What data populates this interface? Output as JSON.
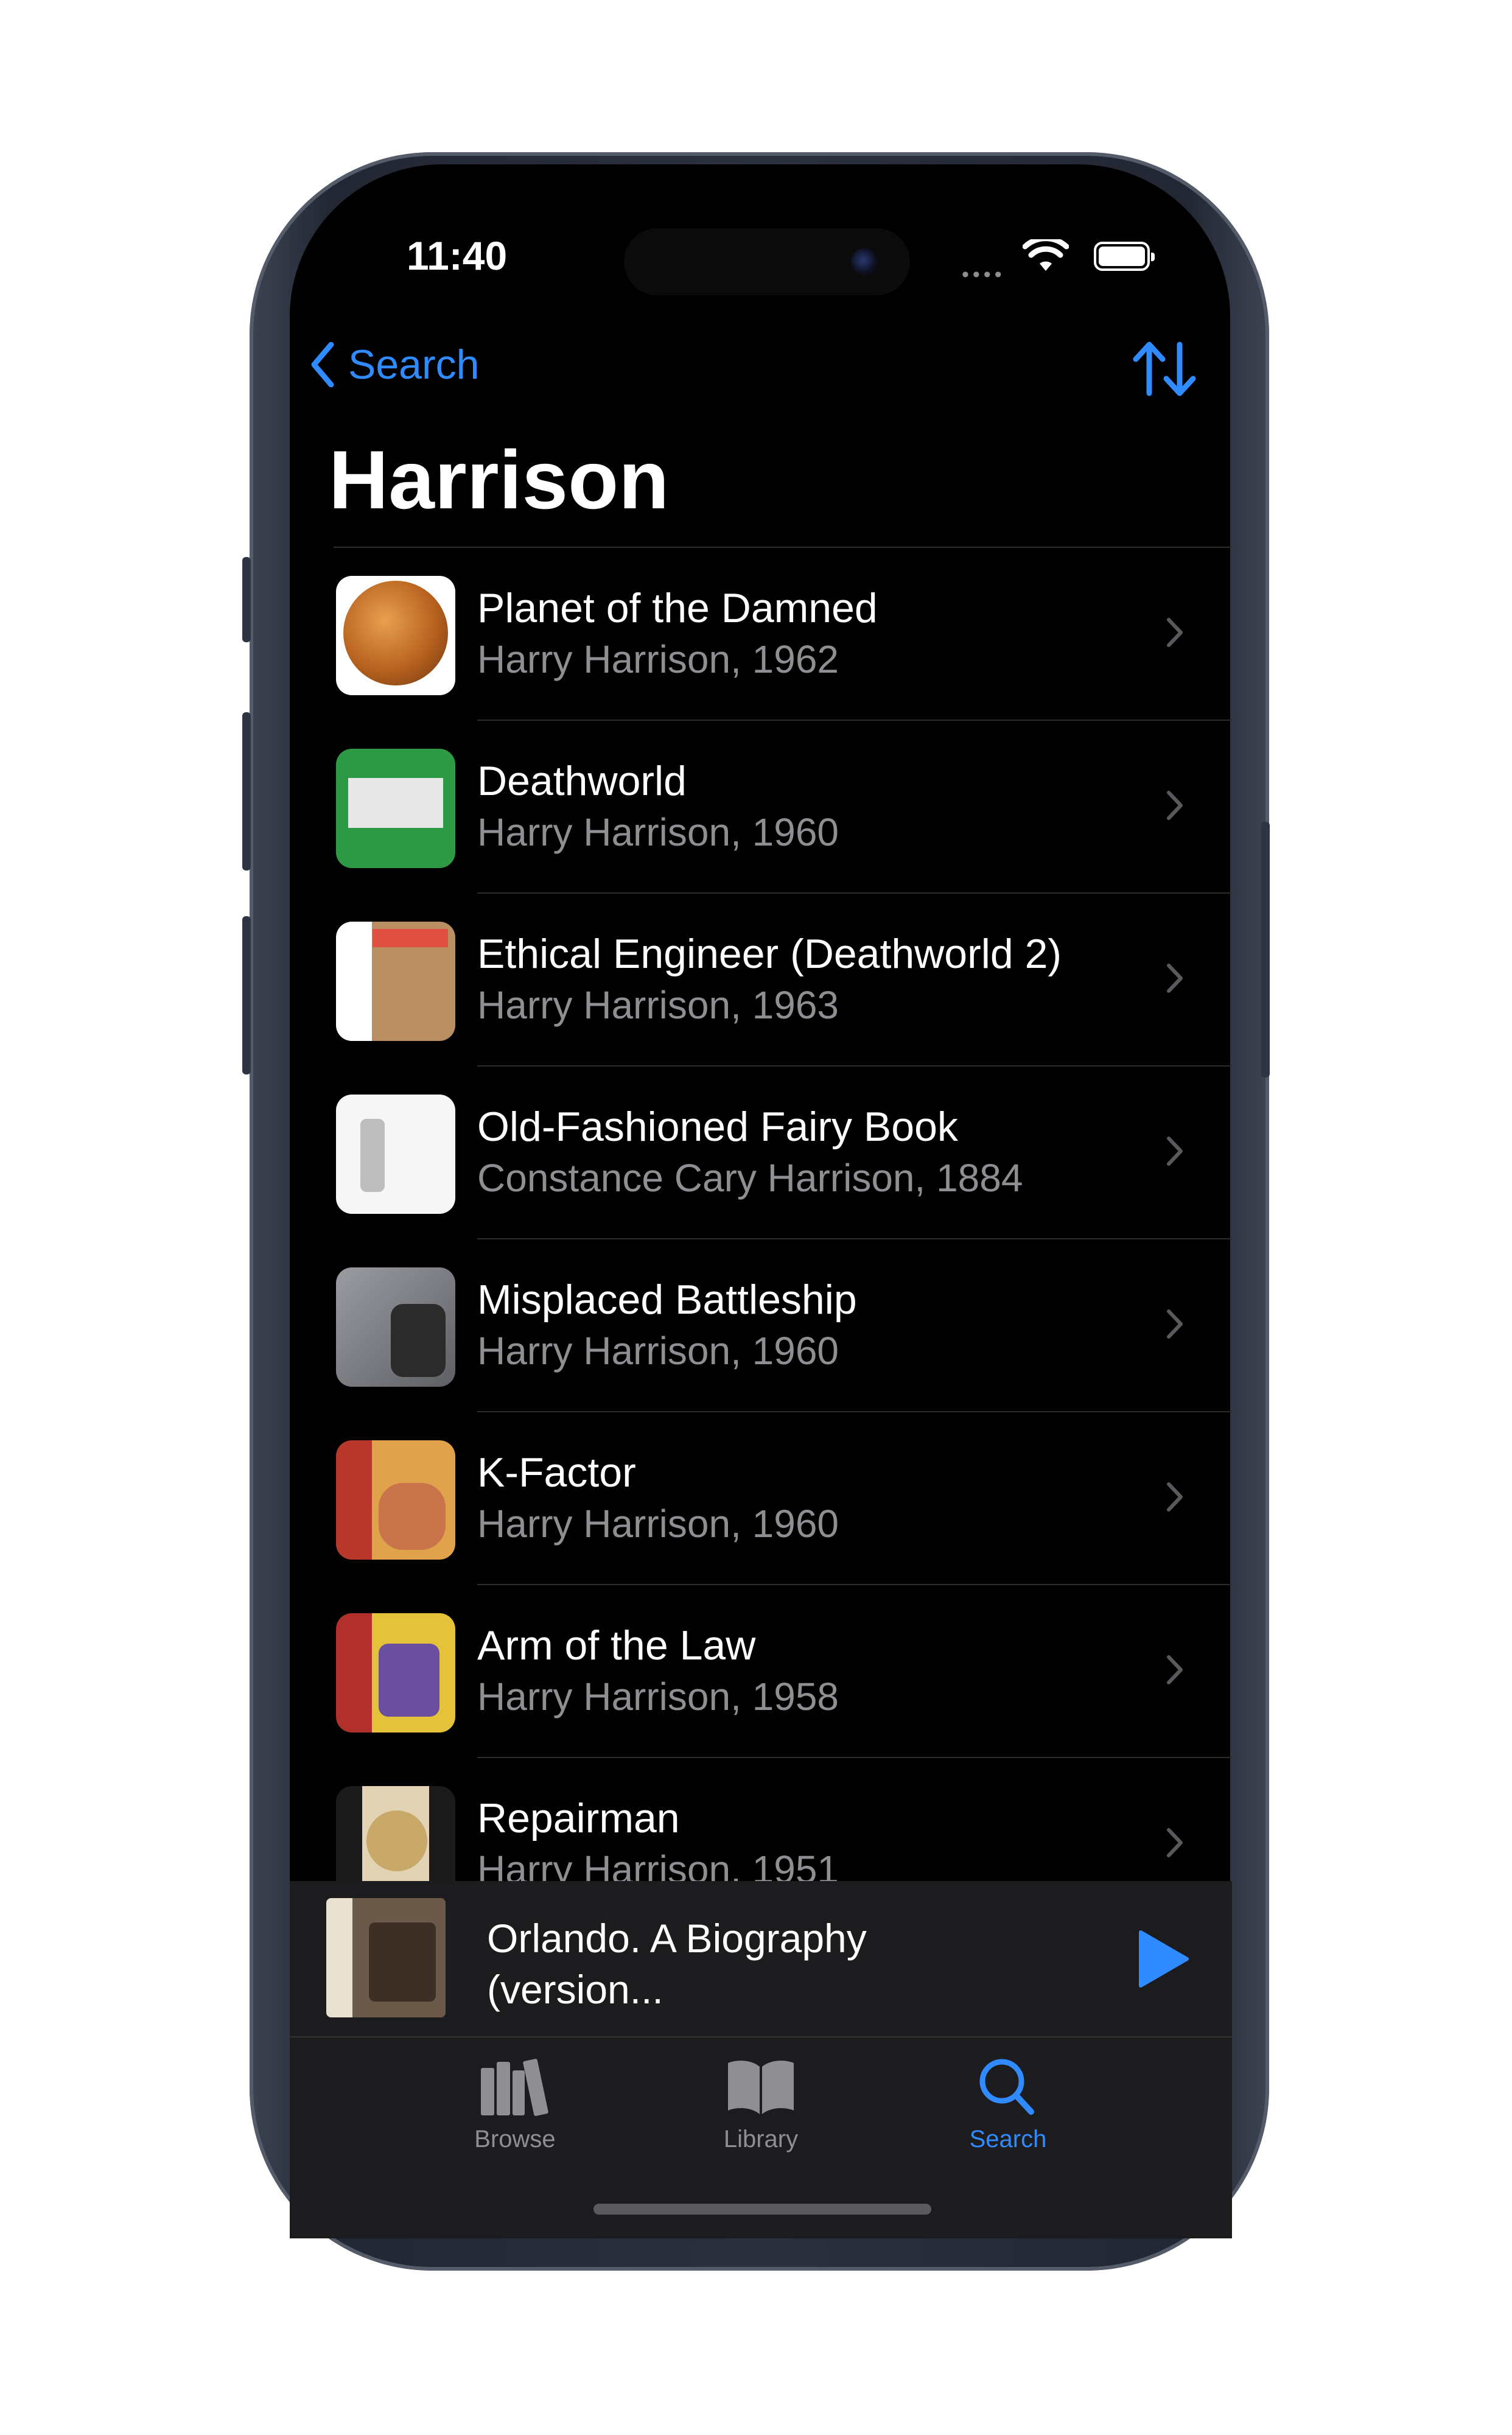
{
  "status": {
    "time": "11:40"
  },
  "nav": {
    "back_label": "Search",
    "title": "Harrison"
  },
  "books": [
    {
      "title": "Planet of the Damned",
      "subtitle": "Harry Harrison, 1962",
      "cover_color": "#c97a2e"
    },
    {
      "title": "Deathworld",
      "subtitle": "Harry Harrison, 1960",
      "cover_color": "#2e9a45"
    },
    {
      "title": "Ethical Engineer (Deathworld 2)",
      "subtitle": "Harry Harrison, 1963",
      "cover_color": "#c8b89a"
    },
    {
      "title": "Old-Fashioned Fairy Book",
      "subtitle": "Constance Cary Harrison, 1884",
      "cover_color": "#f4f4f4"
    },
    {
      "title": "Misplaced Battleship",
      "subtitle": "Harry Harrison, 1960",
      "cover_color": "#8a8d93"
    },
    {
      "title": "K-Factor",
      "subtitle": "Harry Harrison, 1960",
      "cover_color": "#c04a3a"
    },
    {
      "title": "Arm of the Law",
      "subtitle": "Harry Harrison, 1958",
      "cover_color": "#d8b032"
    },
    {
      "title": "Repairman",
      "subtitle": "Harry Harrison, 1951",
      "cover_color": "#d9c8a6"
    }
  ],
  "now_playing": {
    "title": "Orlando. A Biography (version..."
  },
  "tabs": [
    {
      "label": "Browse",
      "icon": "books-icon",
      "active": false
    },
    {
      "label": "Library",
      "icon": "open-book-icon",
      "active": false
    },
    {
      "label": "Search",
      "icon": "search-icon",
      "active": true
    }
  ],
  "colors": {
    "accent": "#2f8bff",
    "inactive": "#8e8e93",
    "background": "#000000"
  }
}
